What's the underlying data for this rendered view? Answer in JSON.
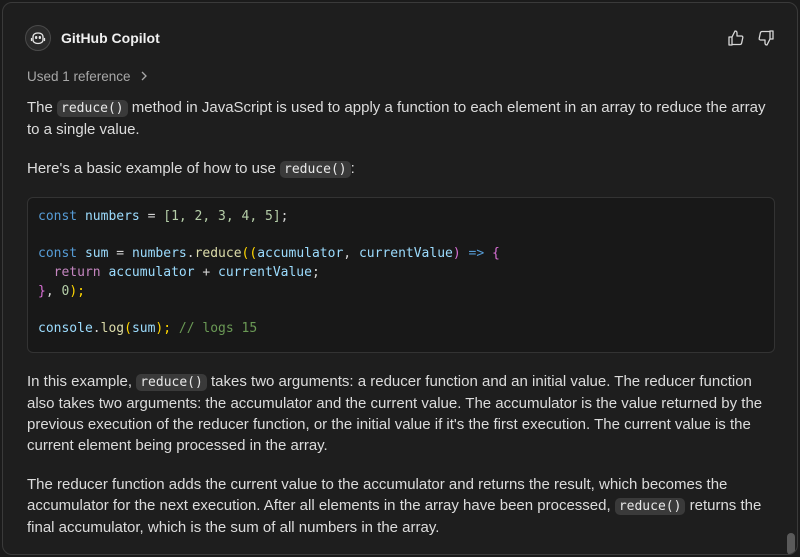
{
  "header": {
    "title": "GitHub Copilot"
  },
  "references": {
    "label": "Used 1 reference"
  },
  "message": {
    "p1_before": "The ",
    "p1_code": "reduce()",
    "p1_after": " method in JavaScript is used to apply a function to each element in an array to reduce the array to a single value.",
    "p2_before": "Here's a basic example of how to use ",
    "p2_code": "reduce()",
    "p2_after": ":",
    "code": {
      "l1_kw": "const",
      "l1_var": "numbers",
      "l1_eq": " = ",
      "l1_arr": "[1, 2, 3, 4, 5]",
      "l1_end": ";",
      "l3_kw": "const",
      "l3_var": "sum",
      "l3_eq": " = ",
      "l3_obj": "numbers",
      "l3_dot": ".",
      "l3_fn": "reduce",
      "l3_open": "((",
      "l3_p1": "accumulator",
      "l3_comma": ", ",
      "l3_p2": "currentValue",
      "l3_close": ")",
      "l3_arrow": " => ",
      "l3_brace": "{",
      "l4_kw": "return",
      "l4_a": "accumulator",
      "l4_plus": " + ",
      "l4_b": "currentValue",
      "l4_end": ";",
      "l5_brace": "}",
      "l5_rest": ", ",
      "l5_num": "0",
      "l5_close": ");",
      "l7_obj": "console",
      "l7_dot": ".",
      "l7_fn": "log",
      "l7_open": "(",
      "l7_arg": "sum",
      "l7_close": ");",
      "l7_comment": "// logs 15"
    },
    "p3_before": "In this example, ",
    "p3_code": "reduce()",
    "p3_after": " takes two arguments: a reducer function and an initial value. The reducer function also takes two arguments: the accumulator and the current value. The accumulator is the value returned by the previous execution of the reducer function, or the initial value if it's the first execution. The current value is the current element being processed in the array.",
    "p4_before": "The reducer function adds the current value to the accumulator and returns the result, which becomes the accumulator for the next execution. After all elements in the array have been processed, ",
    "p4_code": "reduce()",
    "p4_after": " returns the final accumulator, which is the sum of all numbers in the array."
  },
  "icons": {
    "avatar": "copilot-icon",
    "thumbs_up": "thumbs-up-icon",
    "thumbs_down": "thumbs-down-icon",
    "chevron": "chevron-right-icon"
  }
}
